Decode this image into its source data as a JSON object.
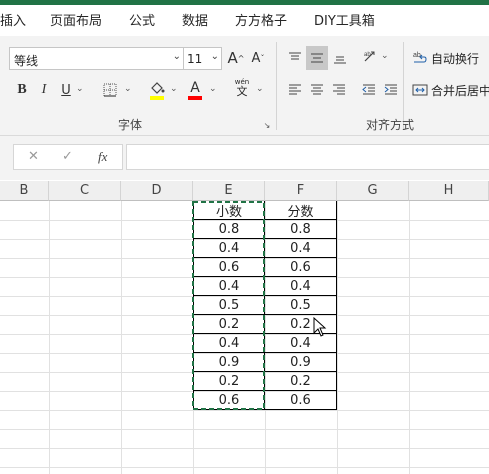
{
  "menu": {
    "tabs": [
      "插入",
      "页面布局",
      "公式",
      "数据",
      "方方格子",
      "DIY工具箱"
    ]
  },
  "ribbon": {
    "font_name": "等线",
    "font_size": "11",
    "grow_font": "A",
    "shrink_font": "A",
    "bold": "B",
    "italic": "I",
    "underline": "U",
    "font_color_glyph": "A",
    "wen": "wén",
    "wen_char": "文",
    "font_group_label": "字体",
    "wrap_text_label": "自动换行",
    "merge_center_label": "合并后居中",
    "align_group_label": "对齐方式",
    "accent_color": "#217346",
    "highlight_color": "#ffff00",
    "font_color": "#ff0000"
  },
  "formula_bar": {
    "cancel_icon": "✕",
    "enter_icon": "✓",
    "fx_label": "fx",
    "value": ""
  },
  "sheet": {
    "columns": [
      "B",
      "C",
      "D",
      "E",
      "F",
      "G",
      "H"
    ],
    "header_e": "小数",
    "header_f": "分数",
    "col_e": [
      "0.8",
      "0.4",
      "0.6",
      "0.4",
      "0.5",
      "0.2",
      "0.4",
      "0.9",
      "0.2",
      "0.6"
    ],
    "col_f": [
      "0.8",
      "0.4",
      "0.6",
      "0.4",
      "0.5",
      "0.2",
      "0.4",
      "0.9",
      "0.2",
      "0.6"
    ]
  }
}
